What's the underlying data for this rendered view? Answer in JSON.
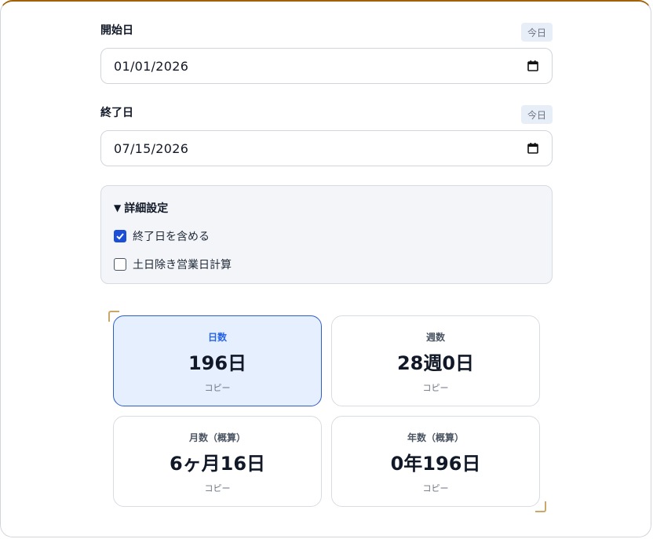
{
  "start": {
    "label": "開始日",
    "today_button": "今日",
    "value": "01/01/2026",
    "icon": "calendar-icon"
  },
  "end": {
    "label": "終了日",
    "today_button": "今日",
    "value": "07/15/2026",
    "icon": "calendar-icon"
  },
  "settings": {
    "title": "詳細設定",
    "toggle_marker": "▼",
    "options": [
      {
        "label": "終了日を含める",
        "checked": true
      },
      {
        "label": "土日除き営業日計算",
        "checked": false
      }
    ]
  },
  "results": [
    {
      "label": "日数",
      "value": "196日",
      "copy": "コピー",
      "active": true
    },
    {
      "label": "週数",
      "value": "28週0日",
      "copy": "コピー",
      "active": false
    },
    {
      "label": "月数（概算）",
      "value": "6ヶ月16日",
      "copy": "コピー",
      "active": false
    },
    {
      "label": "年数（概算）",
      "value": "0年196日",
      "copy": "コピー",
      "active": false
    }
  ],
  "colors": {
    "accent": "#2563eb",
    "checkbox": "#1d4ed8",
    "frame_top": "#a16207"
  }
}
